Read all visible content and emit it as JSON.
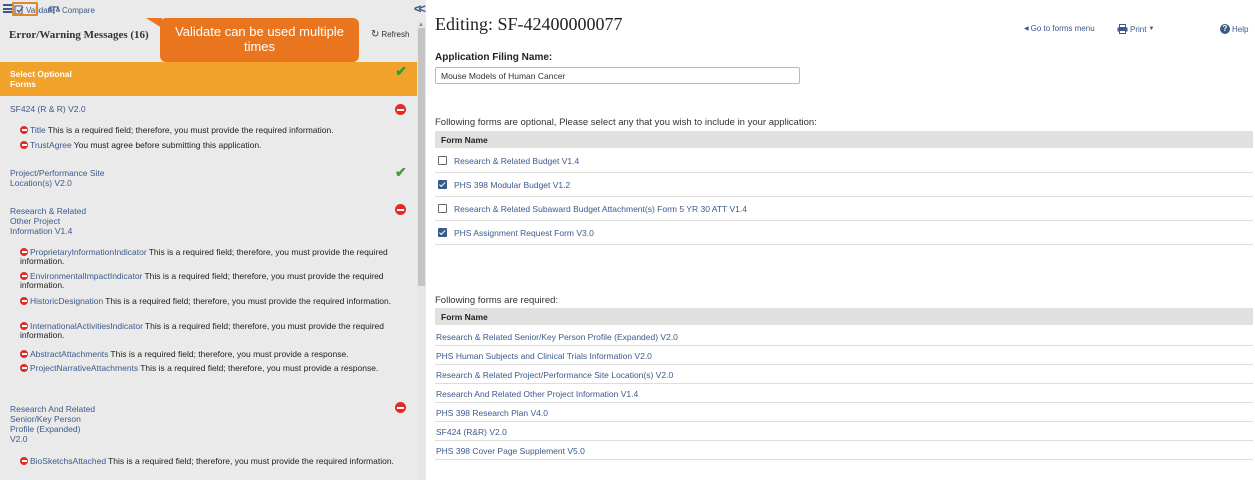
{
  "toolbar": {
    "validate_label": "Validate",
    "compare_label": "Compare"
  },
  "callout": "Validate can be used multiple times",
  "messages_panel": {
    "title": "Error/Warning Messages (16)",
    "refresh_label": "Refresh",
    "select_optional": "Select Optional Forms",
    "sections": [
      {
        "name": "SF424 (R & R) V2.0",
        "status": "error"
      },
      {
        "name": "Project/Performance Site Location(s) V2.0",
        "status": "ok"
      },
      {
        "name": "Research & Related Other Project Information V1.4",
        "status": "error"
      },
      {
        "name": "Research And Related Senior/Key Person Profile (Expanded) V2.0",
        "status": "error"
      }
    ],
    "messages": [
      {
        "field": "Title",
        "text": "This is a required field; therefore, you must provide the required information."
      },
      {
        "field": "TrustAgree",
        "text": "You must agree before submitting this application."
      },
      {
        "field": "ProprietaryInformationIndicator",
        "text": "This is a required field; therefore, you must provide the required information."
      },
      {
        "field": "EnvironmentalImpactIndicator",
        "text": "This is a required field; therefore, you must provide the required information."
      },
      {
        "field": "HistoricDesignation",
        "text": "This is a required field; therefore, you must provide the required information."
      },
      {
        "field": "InternationalActivitiesIndicator",
        "text": "This is a required field; therefore, you must provide the required information."
      },
      {
        "field": "AbstractAttachments",
        "text": "This is a required field; therefore, you must provide a response."
      },
      {
        "field": "ProjectNarrativeAttachments",
        "text": "This is a required field; therefore, you must provide a response."
      },
      {
        "field": "BioSketchsAttached",
        "text": "This is a required field; therefore, you must provide the required information."
      }
    ]
  },
  "editor": {
    "title": "Editing: SF-42400000077",
    "nav": {
      "goto": "Go to forms menu",
      "print": "Print",
      "help": "Help"
    },
    "filing_label": "Application Filing Name:",
    "filing_value": "Mouse Models of Human Cancer",
    "optional_intro": "Following forms are optional, Please select any that you wish to include in your application:",
    "optional_header": "Form Name",
    "optional_forms": [
      {
        "name": "Research & Related Budget V1.4",
        "checked": false
      },
      {
        "name": "PHS 398 Modular Budget V1.2",
        "checked": true
      },
      {
        "name": "Research & Related Subaward Budget Attachment(s) Form 5 YR 30 ATT V1.4",
        "checked": false
      },
      {
        "name": "PHS Assignment Request Form V3.0",
        "checked": true
      }
    ],
    "required_intro": "Following forms are required:",
    "required_header": "Form Name",
    "required_forms": [
      "Research & Related Senior/Key Person Profile (Expanded) V2.0",
      "PHS Human Subjects and Clinical Trials Information V2.0",
      "Research & Related Project/Performance Site Location(s) V2.0",
      "Research And Related Other Project Information V1.4",
      "PHS 398 Research Plan V4.0",
      "SF424 (R&R) V2.0",
      "PHS 398 Cover Page Supplement V5.0"
    ]
  },
  "colors": {
    "accent": "#e9761f",
    "link": "#3b5a8c",
    "error": "#e12b28",
    "ok": "#4a9a3f",
    "banner": "#f0a22a"
  }
}
